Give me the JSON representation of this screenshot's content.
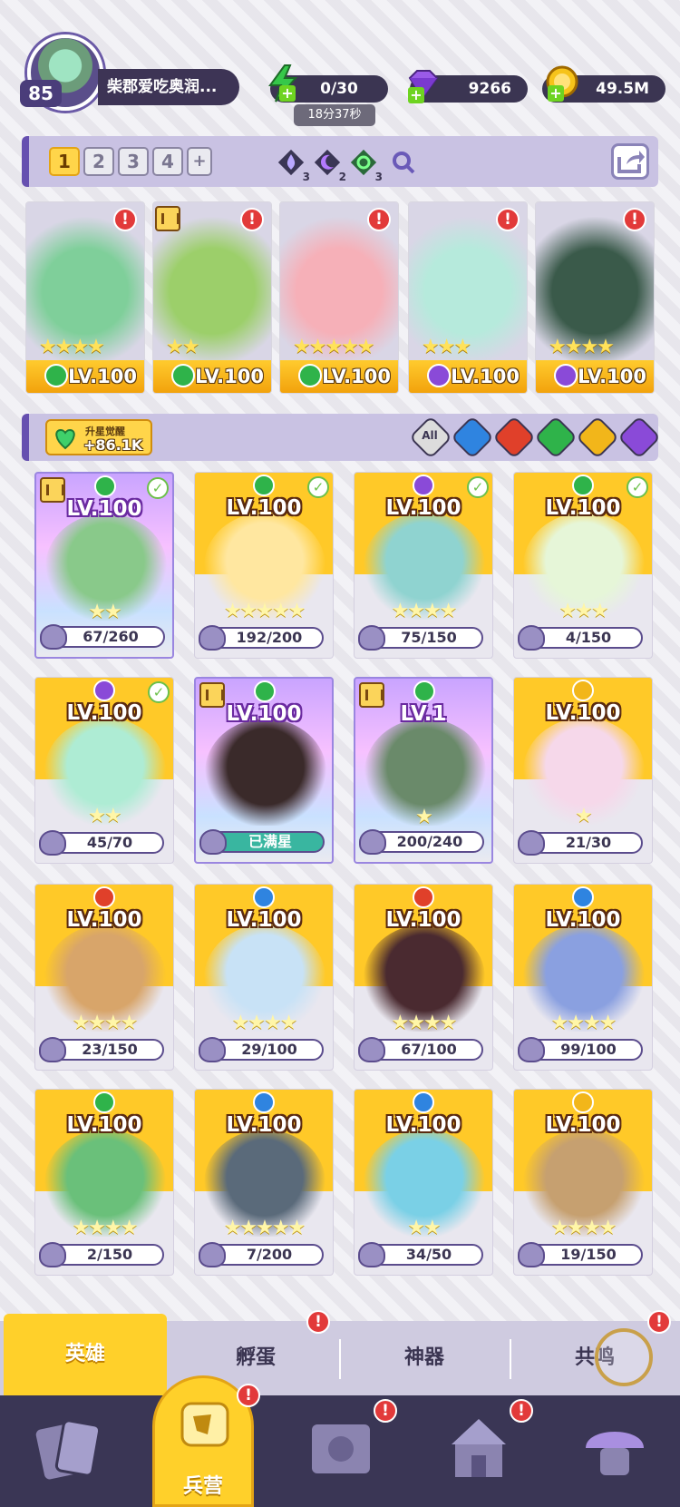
{
  "player": {
    "level": "85",
    "name": "柴郡爱吃奥润..."
  },
  "resources": {
    "energy": {
      "value": "0/30",
      "timer": "18分37秒",
      "icon": "lightning-icon",
      "color": "#36c84a"
    },
    "gems": {
      "value": "9266",
      "icon": "gem-icon",
      "color": "#8a4ad8"
    },
    "gold": {
      "value": "49.5M",
      "icon": "gold-coin-icon",
      "color": "#f2b61a"
    }
  },
  "team_bar": {
    "tabs": [
      "1",
      "2",
      "3",
      "4",
      "+"
    ],
    "active_tab": "1",
    "element_counts": [
      {
        "element": "water",
        "count": "3"
      },
      {
        "element": "dark",
        "count": "2"
      },
      {
        "element": "nature",
        "count": "3"
      }
    ]
  },
  "team": [
    {
      "element": "nature",
      "stars": "★★★★",
      "level": "LV.100",
      "alert": true
    },
    {
      "element": "nature",
      "stars": "★★",
      "level": "LV.100",
      "alert": true,
      "rank": true
    },
    {
      "element": "nature",
      "stars": "★★★★★",
      "level": "LV.100",
      "alert": true
    },
    {
      "element": "dark",
      "stars": "★★★",
      "level": "LV.100",
      "alert": true
    },
    {
      "element": "dark",
      "stars": "★★★★",
      "level": "LV.100",
      "alert": true
    }
  ],
  "filter": {
    "awaken_label": "升星觉醒",
    "awaken_value": "+86.1K",
    "all_label": "All",
    "elements": [
      "water",
      "fire",
      "nature",
      "light",
      "dark"
    ]
  },
  "heroes": [
    {
      "level": "LV.100",
      "shards": "67/260",
      "element": "nature",
      "check": true,
      "purple": true,
      "rank": true,
      "stars": "★★"
    },
    {
      "level": "LV.100",
      "shards": "192/200",
      "element": "nature",
      "check": true,
      "stars": "★★★★★"
    },
    {
      "level": "LV.100",
      "shards": "75/150",
      "element": "dark",
      "check": true,
      "stars": "★★★★"
    },
    {
      "level": "LV.100",
      "shards": "4/150",
      "element": "nature",
      "check": true,
      "stars": "★★★"
    },
    {
      "level": "LV.100",
      "shards": "45/70",
      "element": "dark",
      "check": true,
      "stars": "★★"
    },
    {
      "level": "LV.100",
      "shards": "已满星",
      "element": "nature",
      "purple": true,
      "rank": true,
      "maxed": true,
      "stars": ""
    },
    {
      "level": "LV.1",
      "shards": "200/240",
      "element": "nature",
      "purple": true,
      "rank": true,
      "stars": "★"
    },
    {
      "level": "LV.100",
      "shards": "21/30",
      "element": "light",
      "stars": "★"
    },
    {
      "level": "LV.100",
      "shards": "23/150",
      "element": "fire",
      "stars": "★★★★"
    },
    {
      "level": "LV.100",
      "shards": "29/100",
      "element": "water",
      "stars": "★★★★"
    },
    {
      "level": "LV.100",
      "shards": "67/100",
      "element": "fire",
      "stars": "★★★★"
    },
    {
      "level": "LV.100",
      "shards": "99/100",
      "element": "water",
      "stars": "★★★★"
    },
    {
      "level": "LV.100",
      "shards": "2/150",
      "element": "nature",
      "stars": "★★★★"
    },
    {
      "level": "LV.100",
      "shards": "7/200",
      "element": "water",
      "stars": "★★★★★"
    },
    {
      "level": "LV.100",
      "shards": "34/50",
      "element": "water",
      "stars": "★★"
    },
    {
      "level": "LV.100",
      "shards": "19/150",
      "element": "light",
      "stars": "★★★★"
    }
  ],
  "sub_tabs": [
    "英雄",
    "孵蛋",
    "神器",
    "共鸣"
  ],
  "nav": {
    "barracks_label": "兵营"
  },
  "colors": {
    "accent_yellow": "#ffd02a",
    "panel_purple": "#c9c2e3",
    "dark_bg": "#3a3655",
    "alert_red": "#e23a3a"
  }
}
